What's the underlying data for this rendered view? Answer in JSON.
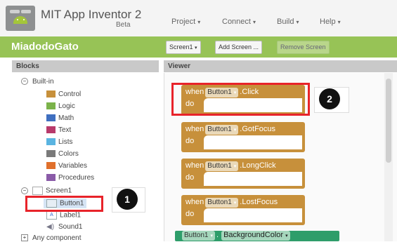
{
  "app": {
    "title": "MIT App Inventor 2",
    "subtitle": "Beta"
  },
  "menu": [
    {
      "label": "Project"
    },
    {
      "label": "Connect"
    },
    {
      "label": "Build"
    },
    {
      "label": "Help"
    }
  ],
  "project": {
    "name": "MiadodoGato",
    "screen_select": "Screen1",
    "add_screen": "Add Screen ...",
    "remove_screen": "Remove Screen"
  },
  "blocks_panel": {
    "heading": "Blocks",
    "builtin_label": "Built-in",
    "builtin": [
      {
        "label": "Control",
        "color": "#c7903b"
      },
      {
        "label": "Logic",
        "color": "#7bb34a"
      },
      {
        "label": "Math",
        "color": "#3f6fc0"
      },
      {
        "label": "Text",
        "color": "#b83a6b"
      },
      {
        "label": "Lists",
        "color": "#5ab4e1"
      },
      {
        "label": "Colors",
        "color": "#7a7a7a"
      },
      {
        "label": "Variables",
        "color": "#e0702c"
      },
      {
        "label": "Procedures",
        "color": "#8a5ba8"
      }
    ],
    "screen_label": "Screen1",
    "components": [
      {
        "label": "Button1",
        "icon": "button-icon"
      },
      {
        "label": "Label1",
        "icon": "label-icon"
      },
      {
        "label": "Sound1",
        "icon": "sound-icon"
      }
    ],
    "any_component": "Any component"
  },
  "viewer": {
    "heading": "Viewer",
    "event_blocks": [
      {
        "when": "when",
        "component": "Button1",
        "event": ".Click",
        "do": "do"
      },
      {
        "when": "when",
        "component": "Button1",
        "event": ".GotFocus",
        "do": "do"
      },
      {
        "when": "when",
        "component": "Button1",
        "event": ".LongClick",
        "do": "do"
      },
      {
        "when": "when",
        "component": "Button1",
        "event": ".LostFocus",
        "do": "do"
      }
    ],
    "setter": {
      "component": "Button1",
      "property": "BackgroundColor"
    }
  },
  "annotations": {
    "marker_1": "1",
    "marker_2": "2",
    "highlight_color": "#e8232a"
  }
}
